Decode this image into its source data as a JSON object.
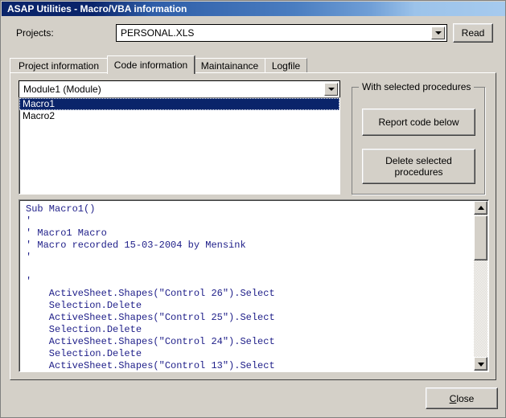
{
  "window": {
    "title": "ASAP Utilities - Macro/VBA information"
  },
  "projects": {
    "label": "Projects:",
    "selected": "PERSONAL.XLS",
    "read_label": "Read"
  },
  "tabs": [
    {
      "label": "Project information",
      "active": false
    },
    {
      "label": "Code information",
      "active": true
    },
    {
      "label": "Maintainance",
      "active": false
    },
    {
      "label": "Logfile",
      "active": false
    }
  ],
  "code_information": {
    "module_combo": {
      "selected": "Module1 (Module)"
    },
    "procedures": [
      {
        "label": "Macro1",
        "selected": true
      },
      {
        "label": "Macro2",
        "selected": false
      }
    ],
    "group": {
      "title": "With selected procedures",
      "report_label": "Report code below",
      "delete_label": "Delete selected\nprocedures"
    },
    "code": "Sub Macro1()\n'\n' Macro1 Macro\n' Macro recorded 15-03-2004 by Mensink\n'\n\n'\n    ActiveSheet.Shapes(\"Control 26\").Select\n    Selection.Delete\n    ActiveSheet.Shapes(\"Control 25\").Select\n    Selection.Delete\n    ActiveSheet.Shapes(\"Control 24\").Select\n    Selection.Delete\n    ActiveSheet.Shapes(\"Control 13\").Select"
  },
  "footer": {
    "close_accel": "C",
    "close_rest": "lose"
  },
  "colors": {
    "titlebar_start": "#0a246a",
    "titlebar_end": "#a6caee",
    "window_bg": "#d4d0c8",
    "selection_bg": "#0a246a",
    "code_text": "#20208a"
  }
}
